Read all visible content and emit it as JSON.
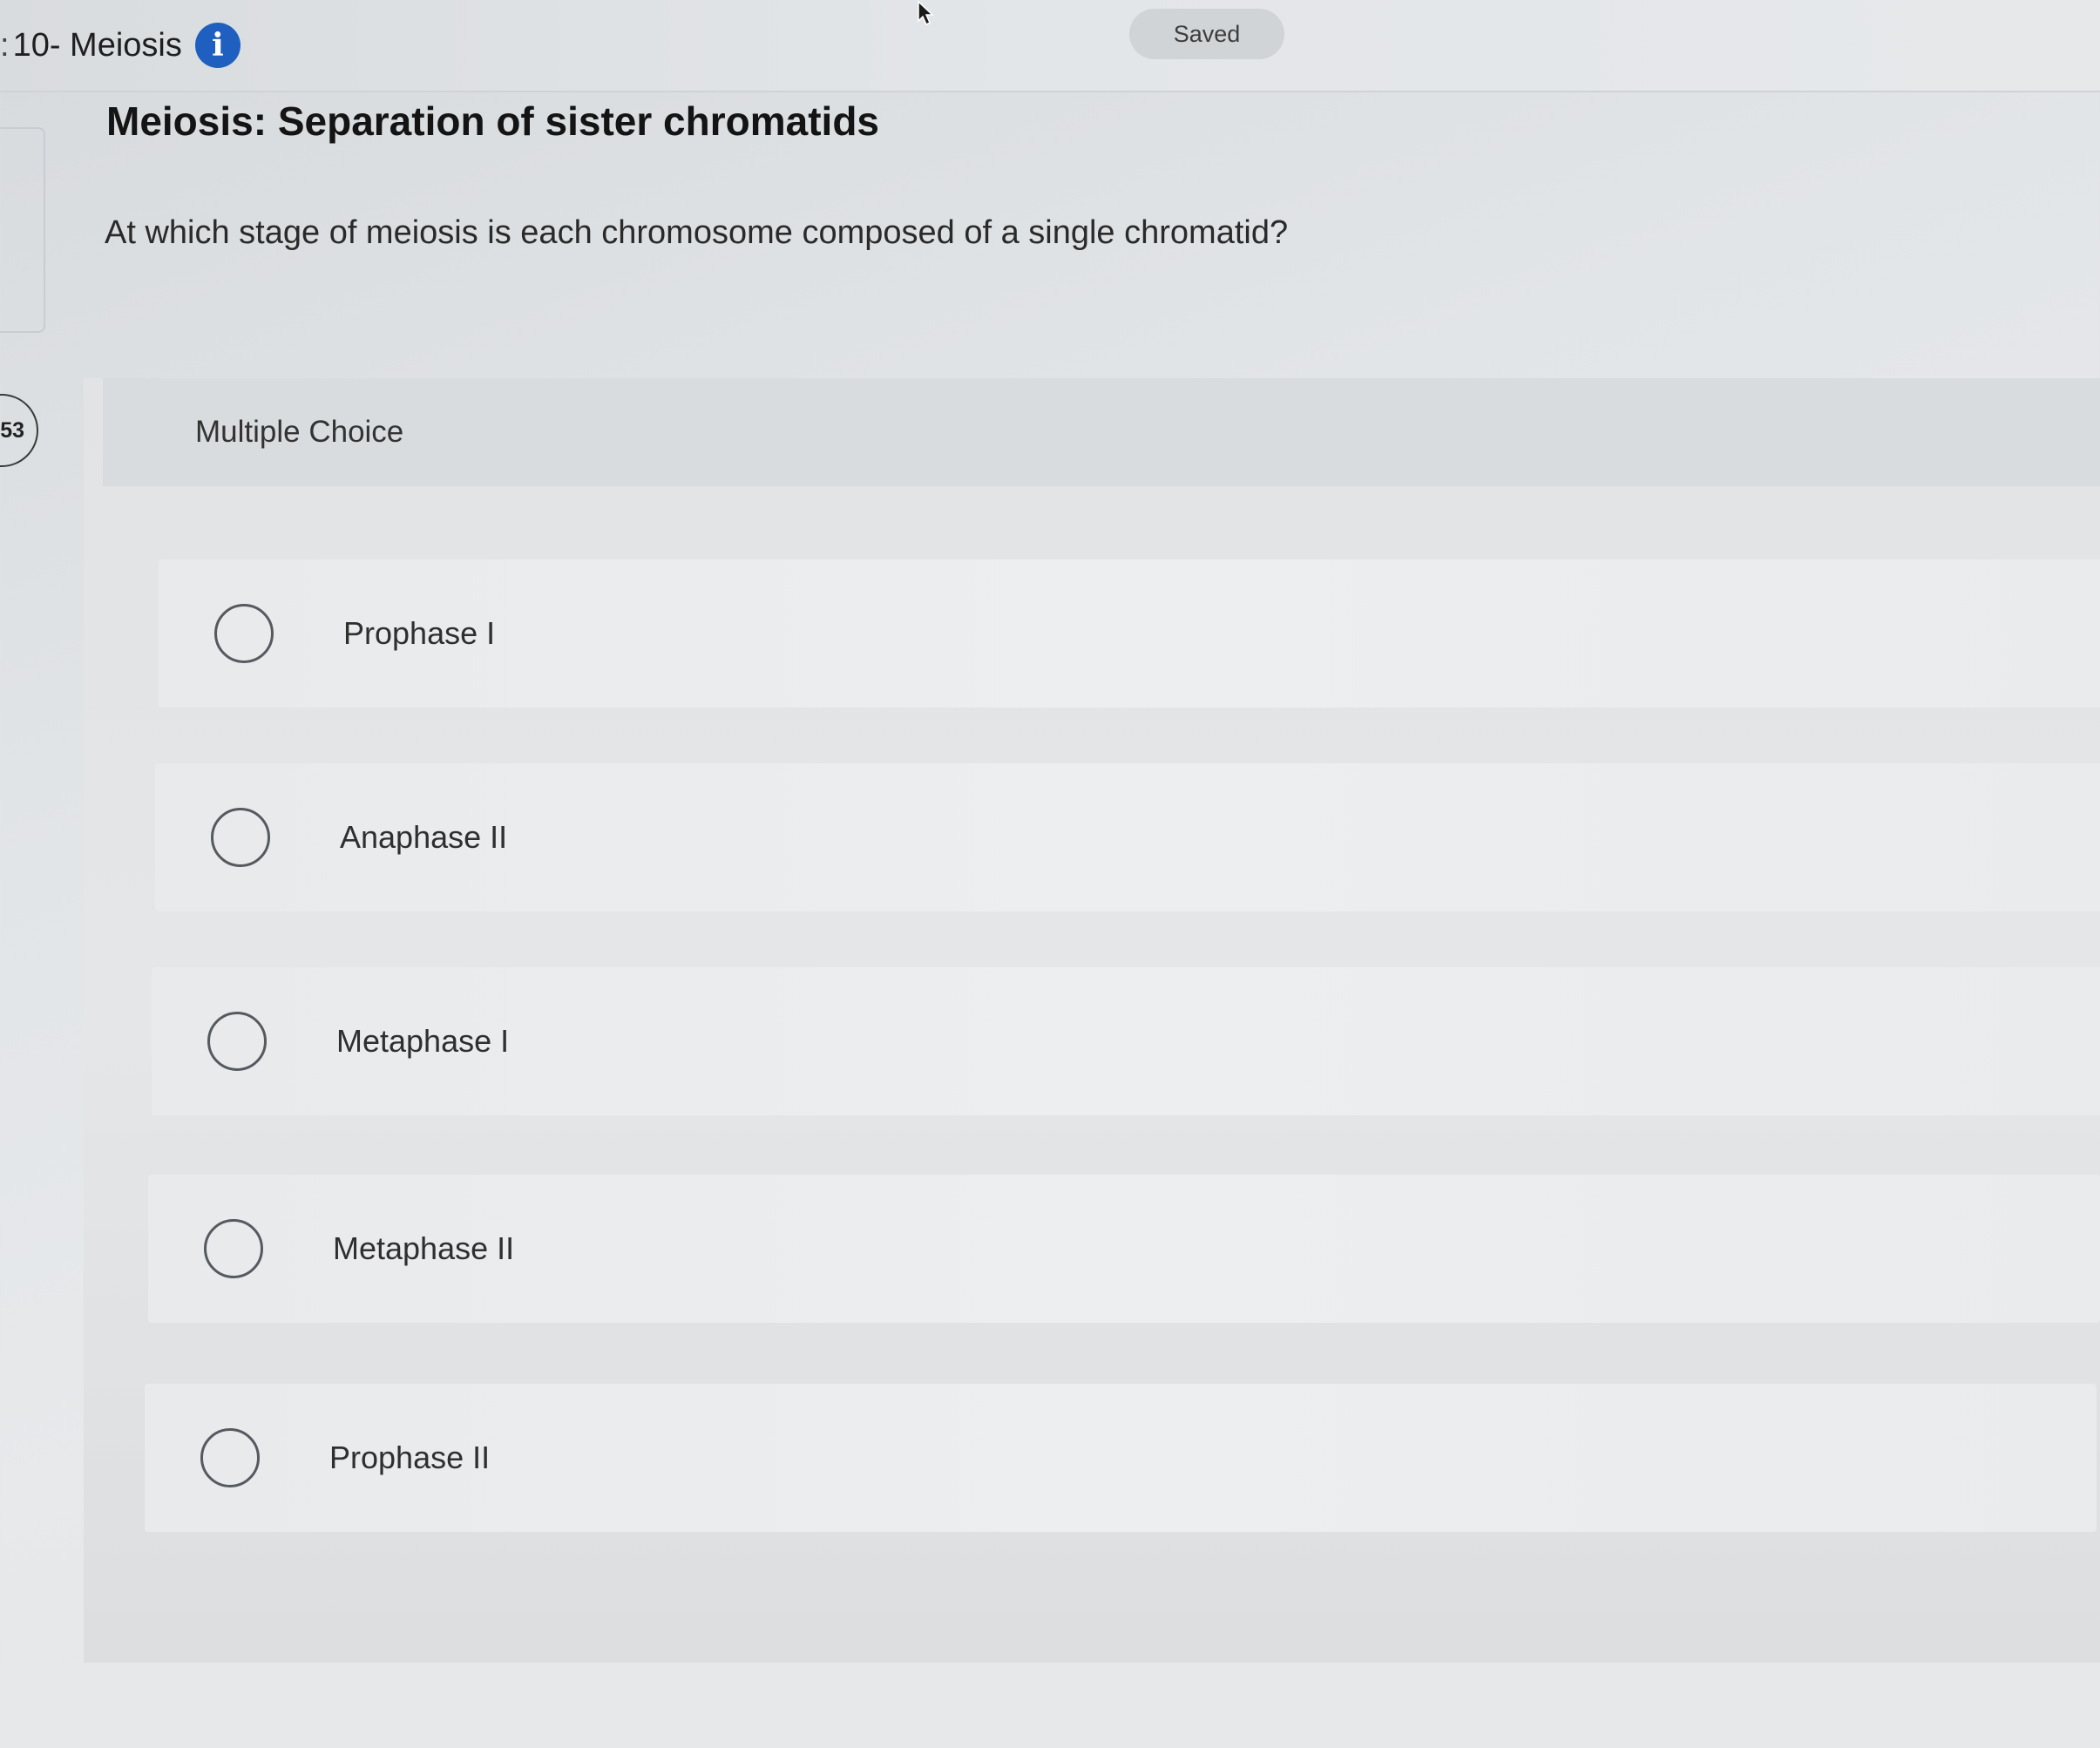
{
  "header": {
    "title_prefix": ":",
    "assignment_title": "10- Meiosis",
    "info_icon": "info-icon",
    "save_status": "Saved"
  },
  "sidebar": {
    "question_number": "53"
  },
  "question": {
    "title": "Meiosis: Separation of sister chromatids",
    "prompt": "At which stage of meiosis is each chromosome composed of a single chromatid?",
    "answer_type": "Multiple Choice",
    "options": [
      {
        "label": "Prophase I",
        "selected": false
      },
      {
        "label": "Anaphase II",
        "selected": false
      },
      {
        "label": "Metaphase I",
        "selected": false
      },
      {
        "label": "Metaphase II",
        "selected": false
      },
      {
        "label": "Prophase II",
        "selected": false
      }
    ]
  },
  "colors": {
    "info_icon": "#1f5fbf",
    "background": "#e2e5e8",
    "radio_border": "#555a60"
  }
}
